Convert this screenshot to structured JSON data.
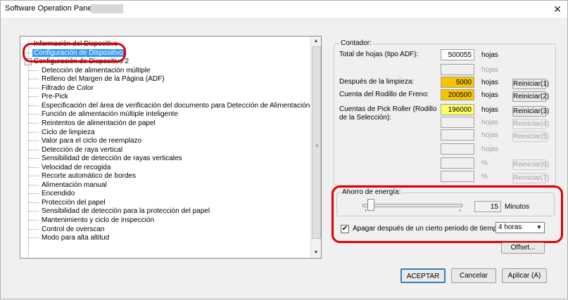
{
  "window": {
    "title": "Software Operation Panel fi-",
    "close_glyph": "✕"
  },
  "tree": {
    "items": [
      {
        "label": "Información del Dispositivo",
        "level": 0,
        "expander": "",
        "selected": false
      },
      {
        "label": "Configuración de Dispositivo",
        "level": 0,
        "expander": "",
        "selected": true
      },
      {
        "label": "Configuración de Dispositivo 2",
        "level": 0,
        "expander": "−",
        "selected": false
      },
      {
        "label": "Detección de alimentación múltiple",
        "level": 1
      },
      {
        "label": "Relleno del Margen de la Página (ADF)",
        "level": 1
      },
      {
        "label": "Filtrado de Color",
        "level": 1
      },
      {
        "label": "Pre-Pick",
        "level": 1
      },
      {
        "label": "Especificación del área de verificación del documento para Detección de Alimentación Múltiple",
        "level": 1
      },
      {
        "label": "Función de alimentación múltiple inteligente",
        "level": 1
      },
      {
        "label": "Reintentos de alimentación de papel",
        "level": 1
      },
      {
        "label": "Ciclo de limpieza",
        "level": 1
      },
      {
        "label": "Valor para el ciclo de reemplazo",
        "level": 1
      },
      {
        "label": "Detección de raya vertical",
        "level": 1
      },
      {
        "label": "Sensibilidad de detección de rayas verticales",
        "level": 1
      },
      {
        "label": "Velocidad de recogida",
        "level": 1
      },
      {
        "label": "Recorte automático de bordes",
        "level": 1
      },
      {
        "label": "Alimentación manual",
        "level": 1
      },
      {
        "label": "Encendido",
        "level": 1
      },
      {
        "label": "Protección del papel",
        "level": 1
      },
      {
        "label": "Sensibilidad de detección para la protección del papel",
        "level": 1
      },
      {
        "label": "Mantenimiento y ciclo de inspección",
        "level": 1
      },
      {
        "label": "Control de overscan",
        "level": 1
      },
      {
        "label": "Modo para alta altitud",
        "level": 1
      }
    ],
    "scroll_up": "▲",
    "scroll_down": "▼",
    "scroll_grip": "≡"
  },
  "contador": {
    "legend": "Contador:",
    "rows": [
      {
        "label": "Total de hojas (tipo ADF):",
        "value": "500055",
        "unit": "hojas",
        "unit_disabled": false,
        "color": "white",
        "button": ""
      },
      {
        "label": "",
        "value": "",
        "unit": "hojas",
        "unit_disabled": true,
        "color": "none",
        "button": ""
      },
      {
        "label": "Después de la limpieza:",
        "value": "5000",
        "unit": "hojas",
        "unit_disabled": false,
        "color": "#f6c500",
        "button": "Reiniciar(1)",
        "button_disabled": false
      },
      {
        "label": "Cuenta del Rodillo de Freno:",
        "value": "200500",
        "unit": "hojas",
        "unit_disabled": false,
        "color": "#f6c500",
        "button": "Reiniciar(2)",
        "button_disabled": false
      },
      {
        "label": "Cuentas de Pick Roller (Rodillo de la  Selección):",
        "value": "196000",
        "unit": "hojas",
        "unit_disabled": false,
        "color": "#ffff66",
        "button": "Reiniciar(3)",
        "button_disabled": false
      },
      {
        "label": "",
        "value": "",
        "unit": "hojas",
        "unit_disabled": true,
        "color": "none",
        "button": "Reiniciar(4)",
        "button_disabled": true
      },
      {
        "label": "",
        "value": "",
        "unit": "hojas",
        "unit_disabled": true,
        "color": "none",
        "button": "Reiniciar(5)",
        "button_disabled": true
      },
      {
        "label": "",
        "value": "",
        "unit": "hojas",
        "unit_disabled": true,
        "color": "none",
        "button": ""
      },
      {
        "label": "",
        "value": "",
        "unit": "%",
        "unit_disabled": true,
        "color": "none",
        "button": "Reiniciar(6)",
        "button_disabled": true
      },
      {
        "label": "",
        "value": "",
        "unit": "%",
        "unit_disabled": true,
        "color": "none",
        "button": "Reiniciar(7)",
        "button_disabled": true
      }
    ]
  },
  "energia": {
    "legend": "Ahorro de energía:",
    "slider_fraction": 0.05,
    "value": "15",
    "unit": "Minutos",
    "checkbox_checked": true,
    "checkbox_mark": "✔",
    "checkbox_label": "Apagar después de un cierto periodo de tiempo",
    "select_value": "4 horas",
    "select_caret": "▼"
  },
  "buttons": {
    "offset": "Offset...",
    "ok": "ACEPTAR",
    "cancel": "Cancelar",
    "apply": "Aplicar (A)"
  },
  "highlight_color": "#e00000"
}
